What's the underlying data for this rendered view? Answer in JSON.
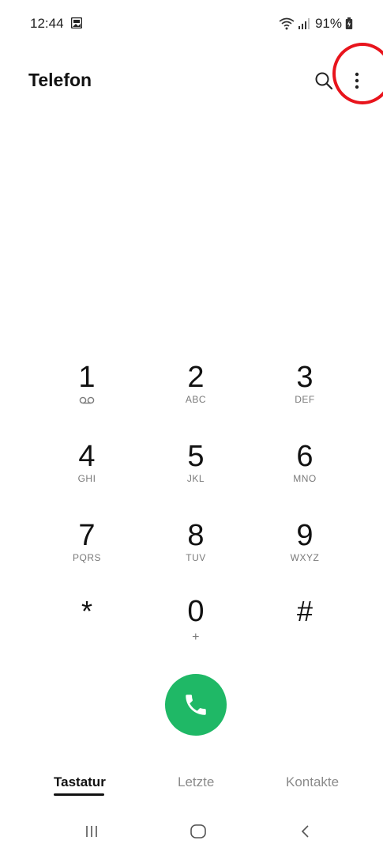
{
  "status_bar": {
    "time": "12:44",
    "battery": "91%",
    "icons": [
      "gallery-notification-icon",
      "wifi-icon",
      "signal-icon",
      "battery-icon"
    ]
  },
  "app_bar": {
    "title": "Telefon",
    "search_icon": "search-icon",
    "more_icon": "more-options-icon"
  },
  "keypad": {
    "keys": [
      {
        "digit": "1",
        "letters": ""
      },
      {
        "digit": "2",
        "letters": "ABC"
      },
      {
        "digit": "3",
        "letters": "DEF"
      },
      {
        "digit": "4",
        "letters": "GHI"
      },
      {
        "digit": "5",
        "letters": "JKL"
      },
      {
        "digit": "6",
        "letters": "MNO"
      },
      {
        "digit": "7",
        "letters": "PQRS"
      },
      {
        "digit": "8",
        "letters": "TUV"
      },
      {
        "digit": "9",
        "letters": "WXYZ"
      },
      {
        "digit": "*",
        "letters": ""
      },
      {
        "digit": "0",
        "letters": "+"
      },
      {
        "digit": "#",
        "letters": ""
      }
    ]
  },
  "call_button": {
    "icon": "phone-icon",
    "color": "#1fb866"
  },
  "tabs": [
    {
      "label": "Tastatur",
      "active": true
    },
    {
      "label": "Letzte",
      "active": false
    },
    {
      "label": "Kontakte",
      "active": false
    }
  ],
  "nav_bar": {
    "icons": [
      "recent-apps-icon",
      "home-icon",
      "back-icon"
    ]
  },
  "colors": {
    "highlight_ring": "#e8141c",
    "call_green": "#1fb866"
  }
}
